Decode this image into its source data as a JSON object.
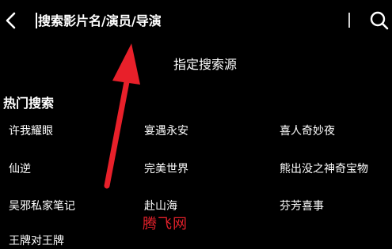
{
  "search": {
    "placeholder": "搜索影片名/演员/导演",
    "back_icon": "chevron-left-icon",
    "search_icon": "search-icon"
  },
  "source_link": "指定搜索源",
  "hot": {
    "title": "热门搜索",
    "items": [
      "许我耀眼",
      "宴遇永安",
      "喜人奇妙夜",
      "仙逆",
      "完美世界",
      "熊出没之神奇宝物",
      "吴邪私家笔记",
      "赴山海",
      "芬芳喜事",
      "王牌对王牌"
    ]
  },
  "watermark": "腾飞网",
  "colors": {
    "background": "#000000",
    "text": "#ffffff",
    "annotation_arrow": "#e8202a",
    "watermark": "#e0202a"
  }
}
